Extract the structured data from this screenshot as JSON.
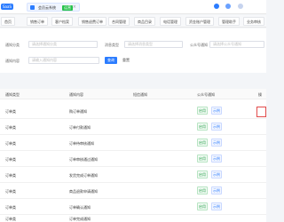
{
  "topbar": {
    "logo": "SaaS",
    "active_app": {
      "name": "会员云系统",
      "badge": "运营"
    }
  },
  "module_tabs": [
    "首页",
    "销售订单",
    "客户档案",
    "销售退费订单",
    "合同管理",
    "商品目录",
    "电话管理",
    "资金账户管理",
    "管理助手",
    "业务审核"
  ],
  "filters": {
    "row1": [
      {
        "label": "通知分类",
        "placeholder": "请选择通知分类"
      },
      {
        "label": "消息类型",
        "placeholder": "请选择消息类型"
      },
      {
        "label": "公众号通知",
        "placeholder": "请选择公众号通知"
      }
    ],
    "row2": {
      "label": "通知内容",
      "placeholder": "请输入通知内容"
    },
    "query_label": "查询",
    "reset_label": "重置"
  },
  "table": {
    "headers": [
      "通知类型",
      "通知内容",
      "短信通知",
      "公众号通知",
      "操"
    ],
    "rows": [
      {
        "type": "订单类",
        "content": "购订单通知",
        "btn_a": "启用",
        "btn_b": "示例"
      },
      {
        "type": "订单类",
        "content": "订单付款通知",
        "btn_a": "启用",
        "btn_b": "示例"
      },
      {
        "type": "订单类",
        "content": "订单待审核通知",
        "btn_a": "启用",
        "btn_b": "示例"
      },
      {
        "type": "订单类",
        "content": "订单审核通过通知",
        "btn_a": "启用",
        "btn_b": "示例"
      },
      {
        "type": "订单类",
        "content": "发货完成订单通知",
        "btn_a": "启用",
        "btn_b": "示例"
      },
      {
        "type": "订单类",
        "content": "商品退款申请通知",
        "btn_a": "启用",
        "btn_b": "示例"
      },
      {
        "type": "订单类",
        "content": "订单确认通知",
        "btn_a": "启用",
        "btn_b": "示例"
      },
      {
        "type": "订单类",
        "content": "订单完成通知",
        "btn_a": "启用",
        "btn_b": "示例"
      }
    ]
  }
}
